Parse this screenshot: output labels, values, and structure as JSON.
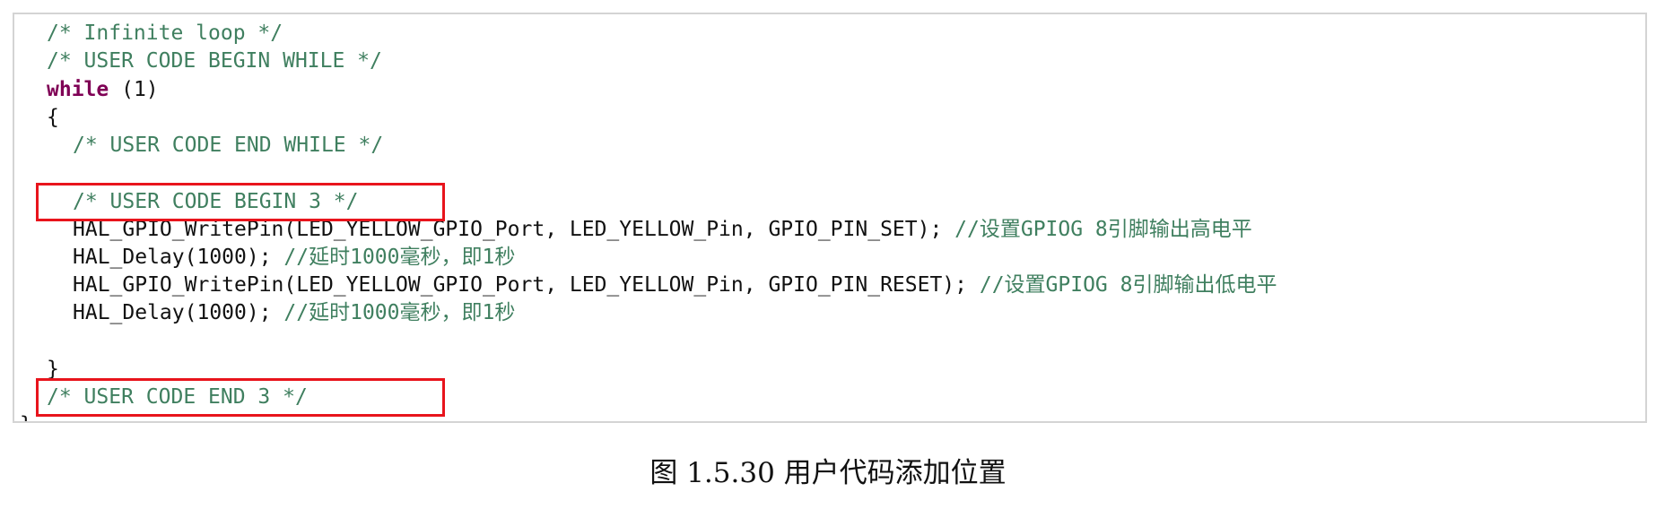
{
  "editor": {
    "lines": [
      {
        "id": "l1",
        "parts": [
          {
            "kind": "comment",
            "text": "/* Infinite loop */"
          }
        ]
      },
      {
        "id": "l2",
        "parts": [
          {
            "kind": "comment",
            "text": "/* USER CODE BEGIN WHILE */"
          }
        ]
      },
      {
        "id": "l3",
        "parts": [
          {
            "kind": "keyword",
            "text": "while"
          },
          {
            "kind": "plain",
            "text": " (1)"
          }
        ]
      },
      {
        "id": "l4",
        "parts": [
          {
            "kind": "plain",
            "text": "{"
          }
        ]
      },
      {
        "id": "l5",
        "parts": [
          {
            "kind": "comment",
            "text": "/* USER CODE END WHILE */"
          }
        ]
      },
      {
        "id": "l6",
        "parts": []
      },
      {
        "id": "l7",
        "parts": [
          {
            "kind": "comment",
            "text": "/* USER CODE BEGIN 3 */"
          }
        ]
      },
      {
        "id": "l8",
        "parts": [
          {
            "kind": "plain",
            "text": "HAL_GPIO_WritePin(LED_YELLOW_GPIO_Port, LED_YELLOW_Pin, GPIO_PIN_SET); "
          },
          {
            "kind": "comment",
            "text": "//设置GPIOG 8引脚输出高电平"
          }
        ]
      },
      {
        "id": "l9",
        "parts": [
          {
            "kind": "plain",
            "text": "HAL_Delay(1000); "
          },
          {
            "kind": "comment",
            "text": "//延时1000毫秒，即1秒"
          }
        ]
      },
      {
        "id": "l10",
        "parts": [
          {
            "kind": "plain",
            "text": "HAL_GPIO_WritePin(LED_YELLOW_GPIO_Port, LED_YELLOW_Pin, GPIO_PIN_RESET); "
          },
          {
            "kind": "comment",
            "text": "//设置GPIOG 8引脚输出低电平"
          }
        ]
      },
      {
        "id": "l11",
        "parts": [
          {
            "kind": "plain",
            "text": "HAL_Delay(1000); "
          },
          {
            "kind": "comment",
            "text": "//延时1000毫秒，即1秒"
          }
        ]
      },
      {
        "id": "l12",
        "parts": []
      },
      {
        "id": "l13",
        "parts": [
          {
            "kind": "plain",
            "text": "}"
          }
        ]
      },
      {
        "id": "l14",
        "parts": [
          {
            "kind": "comment",
            "text": "/* USER CODE END 3 */"
          }
        ]
      },
      {
        "id": "l15",
        "parts": [
          {
            "kind": "plain",
            "text": "}"
          }
        ]
      }
    ]
  },
  "caption": {
    "text": "图 1.5.30 用户代码添加位置"
  },
  "colors": {
    "comment": "#3f7f5f",
    "keyword": "#7f0055",
    "plain": "#111111",
    "highlight_border": "#e8141c",
    "panel_border": "#d4d4d4"
  }
}
